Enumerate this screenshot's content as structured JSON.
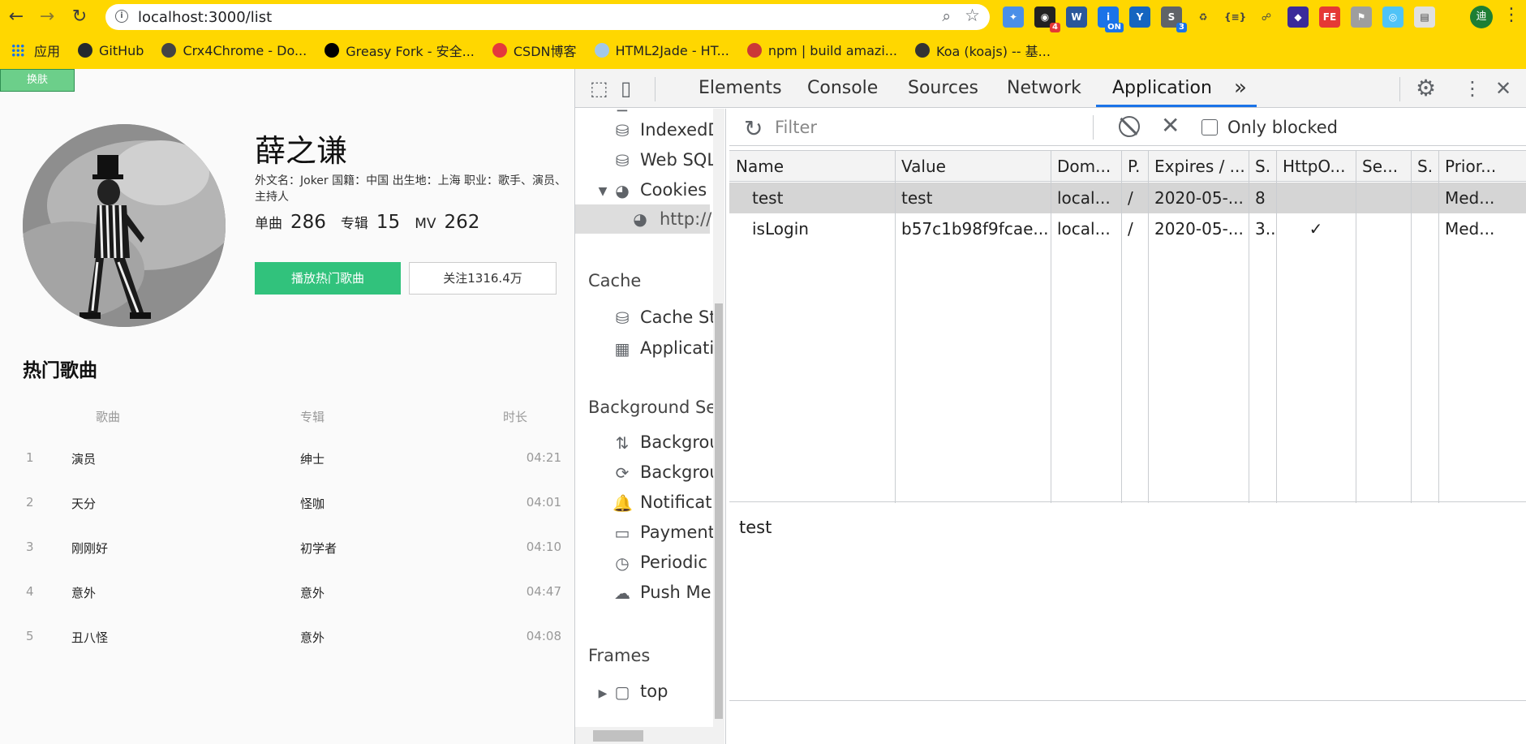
{
  "browser": {
    "url": "localhost:3000/list",
    "profile_initial": "迪",
    "extensions": [
      {
        "name": "feather-extension",
        "color": "#4a8fe8",
        "label": "✦",
        "badge": ""
      },
      {
        "name": "react-devtools-extension",
        "color": "#222222",
        "label": "◉",
        "badge": "4"
      },
      {
        "name": "word-extension",
        "color": "#2b579a",
        "label": "W",
        "badge": ""
      },
      {
        "name": "info-on-extension",
        "color": "#1a73e8",
        "label": "i",
        "badge": "ON"
      },
      {
        "name": "y-extension",
        "color": "#1565c0",
        "label": "Y",
        "badge": ""
      },
      {
        "name": "s-extension",
        "color": "#5f6368",
        "label": "S",
        "badge": "3"
      },
      {
        "name": "recycle-extension",
        "color": "#ffd700",
        "label": "♻",
        "badge": ""
      },
      {
        "name": "json-extension",
        "color": "#ffd700",
        "label": "{≡}",
        "badge": ""
      },
      {
        "name": "network-extension",
        "color": "#ffd700",
        "label": "☍",
        "badge": ""
      },
      {
        "name": "gem-extension",
        "color": "#3a2a9a",
        "label": "◆",
        "badge": ""
      },
      {
        "name": "fe-extension",
        "color": "#e53935",
        "label": "FE",
        "badge": ""
      },
      {
        "name": "flag-extension",
        "color": "#9e9e9e",
        "label": "⚑",
        "badge": ""
      },
      {
        "name": "compass-extension",
        "color": "#4fc3f7",
        "label": "◎",
        "badge": ""
      },
      {
        "name": "calendar-extension",
        "color": "#e0e0e0",
        "label": "▤",
        "badge": ""
      }
    ],
    "bookmarks": [
      {
        "label": "应用",
        "icon_color": "#1a73e8"
      },
      {
        "label": "GitHub",
        "icon_color": "#24292e"
      },
      {
        "label": "Crx4Chrome - Do...",
        "icon_color": "#444444"
      },
      {
        "label": "Greasy Fork - 安全...",
        "icon_color": "#000000"
      },
      {
        "label": "CSDN博客",
        "icon_color": "#e4393c"
      },
      {
        "label": "HTML2Jade - HT...",
        "icon_color": "#a3c8e8"
      },
      {
        "label": "npm | build amazi...",
        "icon_color": "#cb3837"
      },
      {
        "label": "Koa (koajs) -- 基...",
        "icon_color": "#333333"
      }
    ]
  },
  "page": {
    "skin_button": "换肤",
    "artist": {
      "name": "薛之谦",
      "description": "外文名：Joker 国籍：中国 出生地：上海 职业：歌手、演员、主持人",
      "stats": [
        {
          "label": "单曲",
          "value": "286"
        },
        {
          "label": "专辑",
          "value": "15"
        },
        {
          "label": "MV",
          "value": "262"
        }
      ]
    },
    "play_button": "播放热门歌曲",
    "follow_button": "关注1316.4万",
    "hot_songs": {
      "title": "热门歌曲",
      "columns": {
        "song": "歌曲",
        "album": "专辑",
        "duration": "时长"
      },
      "rows": [
        {
          "index": "1",
          "name": "演员",
          "album": "绅士",
          "duration": "04:21"
        },
        {
          "index": "2",
          "name": "天分",
          "album": "怪咖",
          "duration": "04:01"
        },
        {
          "index": "3",
          "name": "刚刚好",
          "album": "初学者",
          "duration": "04:10"
        },
        {
          "index": "4",
          "name": "意外",
          "album": "意外",
          "duration": "04:47"
        },
        {
          "index": "5",
          "name": "丑八怪",
          "album": "意外",
          "duration": "04:08"
        }
      ]
    }
  },
  "devtools": {
    "tabs": [
      "Elements",
      "Console",
      "Sources",
      "Network",
      "Application"
    ],
    "active_tab": "Application",
    "more_tabs": "»",
    "sidebar": {
      "storage_items": [
        "IndexedD",
        "Web SQL",
        "Cookies",
        "http://"
      ],
      "cache_header": "Cache",
      "cache_items": [
        "Cache St",
        "Applicati"
      ],
      "bg_header": "Background Ser",
      "bg_items": [
        "Backgrou",
        "Backgrou",
        "Notificat",
        "Payment",
        "Periodic",
        "Push Me"
      ],
      "frames_header": "Frames",
      "frames_items": [
        "top"
      ]
    },
    "filter_placeholder": "Filter",
    "only_blocked_label": "Only blocked",
    "cookie_table": {
      "columns": [
        "Name",
        "Value",
        "Dom...",
        "P.",
        "Expires / ...",
        "S.",
        "HttpO...",
        "Se...",
        "S.",
        "Prior..."
      ],
      "rows": [
        [
          "test",
          "test",
          "local...",
          "/",
          "2020-05-...",
          "8",
          "",
          "",
          "",
          "Med..."
        ],
        [
          "isLogin",
          "b57c1b98f9fcae...",
          "local...",
          "/",
          "2020-05-...",
          "3..",
          "✓",
          "",
          "",
          "Med..."
        ]
      ],
      "selected_row": 0
    },
    "value_preview": "test"
  }
}
